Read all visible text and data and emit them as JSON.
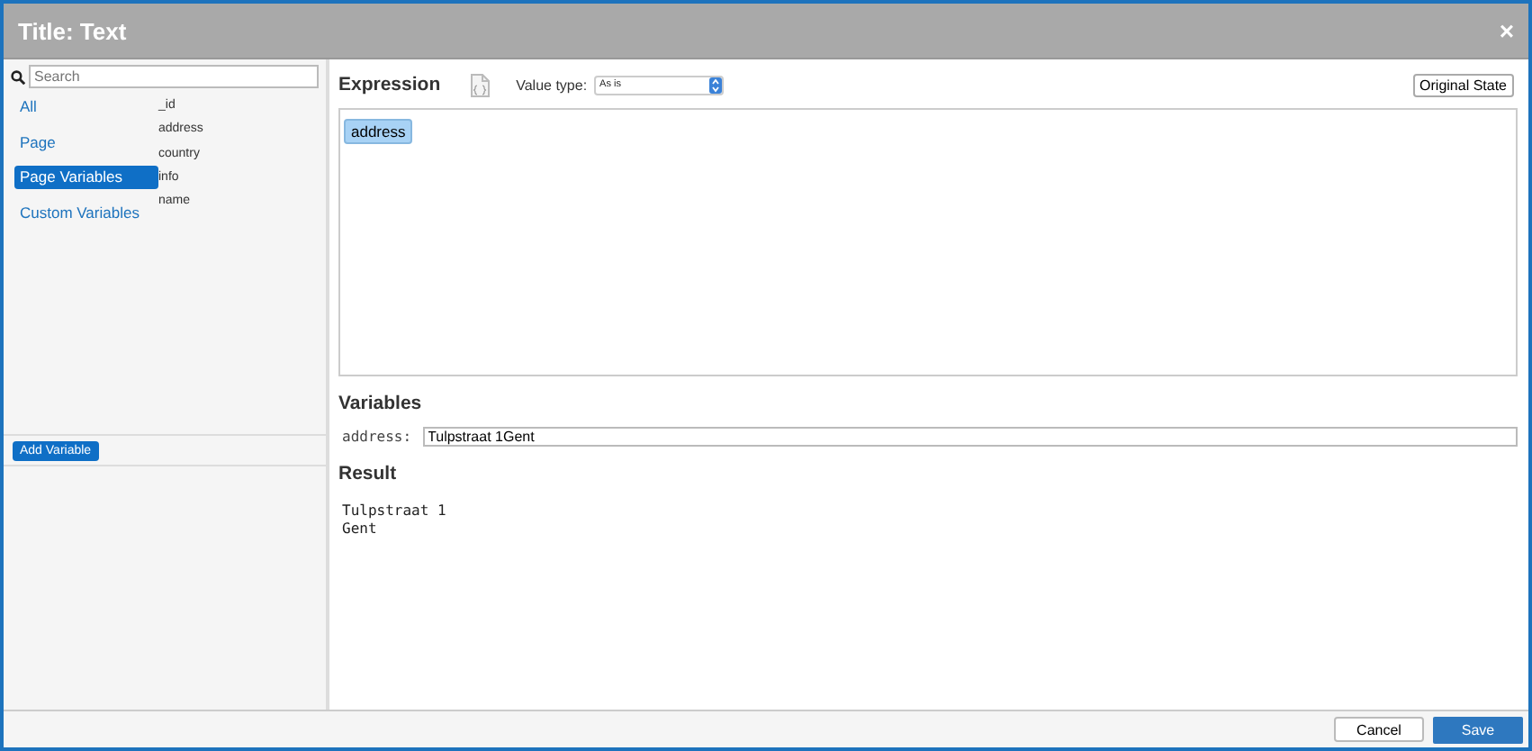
{
  "window": {
    "title": "Title: Text",
    "close": "×"
  },
  "sidebar": {
    "search": {
      "placeholder": "Search"
    },
    "categories": [
      {
        "label": "All",
        "selected": false
      },
      {
        "label": "Page",
        "selected": false
      },
      {
        "label": "Page Variables",
        "selected": true
      },
      {
        "label": "Custom Variables",
        "selected": false
      }
    ],
    "variables": [
      "_id",
      "address",
      "country",
      "info",
      "name"
    ],
    "add_button": "Add Variable"
  },
  "expression": {
    "heading": "Expression",
    "value_type_label": "Value type:",
    "value_type": "As is",
    "original_state_button": "Original State",
    "tokens": [
      "address"
    ]
  },
  "variables": {
    "heading": "Variables",
    "rows": [
      {
        "name": "address:",
        "value": "Tulpstraat 1Gent"
      }
    ]
  },
  "result": {
    "heading": "Result",
    "lines": [
      "Tulpstraat 1",
      "Gent"
    ]
  },
  "buttons": {
    "cancel": "Cancel",
    "save": "Save"
  }
}
